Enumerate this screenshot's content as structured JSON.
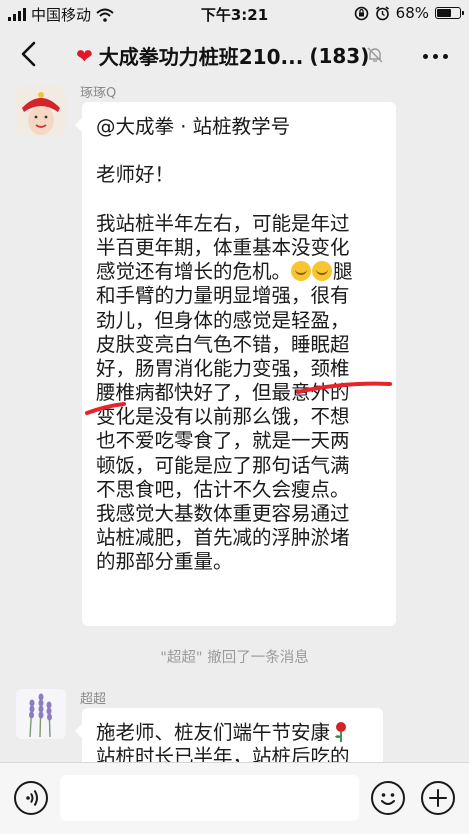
{
  "status_bar": {
    "carrier": "中国移动",
    "time": "下午3:21",
    "battery": "68%",
    "battery_level": 0.68
  },
  "nav": {
    "title": "大成拳功力桩班210...",
    "member_count": "(183)"
  },
  "messages": [
    {
      "sender": "琢琢Q",
      "lines": [
        "@大成拳 · 站桩教学号",
        "",
        "老师好！",
        "",
        "我站桩半年左右，可能是年过",
        "半百更年期，体重基本没变化",
        "感觉还有增长的危机。",
        "腿",
        "和手臂的力量明显增强，很有",
        "劲儿，但身体的感觉是轻盈，",
        "皮肤变亮白气色不错，睡眠超",
        "好，肠胃消化能力变强，颈椎",
        "腰椎病都快好了，但最意外的",
        "变化是没有以前那么饿，不想",
        "也不爱吃零食了，就是一天两",
        "顿饭，可能是应了那句话气满",
        "不思食吧，估计不久会瘦点。",
        "我感觉大基数体重更容易通过",
        "站桩减肥，首先减的浮肿淤堵",
        "的那部分重量。"
      ]
    },
    {
      "sender": "超超",
      "lines": [
        "施老师、桩友们端午节安康",
        "站桩时长已半年，站桩后吃的"
      ]
    }
  ],
  "recall_notice": "\"超超\" 撤回了一条消息",
  "icons": {
    "back": "chevron-left-icon",
    "mute": "bell-slash-icon",
    "more": "ellipsis-icon",
    "voice": "voice-icon",
    "emoji": "smiley-icon",
    "plus": "plus-icon"
  },
  "colors": {
    "background": "#ededed",
    "bubble": "#ffffff",
    "heart": "#e0182b",
    "annotation": "#e8232b"
  }
}
